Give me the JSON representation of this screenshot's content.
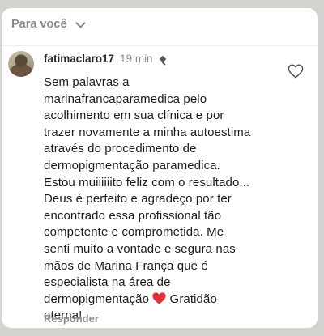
{
  "header": {
    "title": "Para você",
    "chevron_icon": "chevron-down-icon"
  },
  "comment": {
    "username": "fatimaclaro17",
    "time": "19 min",
    "pinned_icon": "pin-icon",
    "text_before_emoji": "Sem palavras a\nmarinafrancaparamedica pelo\nacolhimento em sua clínica e por\ntrazer novamente a minha autoestima\natravés do procedimento de\ndermopigmentação paramedica.\nEstou muiiiiiito feliz com o resultado...\nDeus é perfeito e agradeço por ter\nencontrado essa profissional tão\ncompetente e comprometida. Me\nsenti muito a vontade e segura nas\nmãos de  Marina França que é\nespecialista na área de\ndermopigmentação ",
    "emoji": "red-heart-emoji",
    "text_after_emoji": "  Gratidão\neterna!",
    "like_icon": "heart-outline-icon",
    "reply_label": "Responder"
  },
  "colors": {
    "background": "#d5d3cf",
    "card": "#ffffff",
    "heart_red": "#e0303c",
    "muted_text": "#8e8e8e"
  }
}
